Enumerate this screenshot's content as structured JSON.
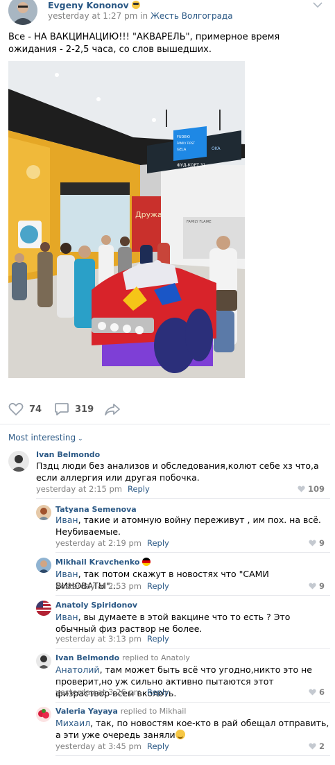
{
  "post": {
    "author": "Evgeny Kononov",
    "time": "yesterday at 1:27 pm",
    "in_word": "in",
    "group": "Жесть Волгограда",
    "text": "Все - НА ВАКЦИНАЦИЮ!!! \"АКВАРЕЛЬ\", примерное время ожидания - 2-2,5 часа, со слов вышедших.",
    "photo_signs": {
      "store_sign": "Дружать",
      "direction_board": [
        "FUDEЮ",
        "FAMILY FIRST",
        "GELA",
        "OKA",
        "ФУД-КОРТ 31"
      ],
      "shop": "FAMILY FLAIRE"
    }
  },
  "actions": {
    "likes": "74",
    "comments": "319"
  },
  "sort_label": "Most interesting",
  "colors": {
    "link": "#2a5885",
    "meta": "#828282",
    "divider": "#e7e8ec"
  },
  "comments": [
    {
      "author": "Ivan Belmondo",
      "replied": "",
      "to": "",
      "text": "Пздц люди без анализов и обследования,колют себе хз что,а если аллергия или другая побочка.",
      "time": "yesterday at 2:15 pm",
      "reply": "Reply",
      "likes": "109"
    },
    {
      "author": "Tatyana Semenova",
      "replied": "",
      "to": "Иван",
      "text": ", такие и атомную войну переживут , им пох. на всё. Неубиваемые.",
      "time": "yesterday at 2:19 pm",
      "reply": "Reply",
      "likes": "9"
    },
    {
      "author": "Mikhail Kravchenko",
      "replied": "",
      "to": "Иван",
      "text": ", так потом скажут в новостях что \"САМИ ВИНОВАТЫ\"...",
      "time": "yesterday at 2:53 pm",
      "reply": "Reply",
      "likes": "9"
    },
    {
      "author": "Anatoly Spiridonov",
      "replied": "",
      "to": "Иван",
      "text": ", вы думаете в этой вакцине что то есть ? Это обычный физ раствор не более.",
      "time": "yesterday at 3:13 pm",
      "reply": "Reply",
      "likes": ""
    },
    {
      "author": "Ivan Belmondo",
      "replied": "replied to Anatoly",
      "to": "Анатолий",
      "text": ", там может быть всё что угодно,никто это не проверит,но уж сильно активно пытаются этот физраствор всем вколоть.",
      "time": "yesterday at 3:26 pm",
      "reply": "Reply",
      "likes": "6"
    },
    {
      "author": "Valeria Yayaya",
      "replied": "replied to Mikhail",
      "to": "Михаил",
      "text": ", так, по новостям кое-кто в рай обещал отправить, а эти уже очередь заняли",
      "time": "yesterday at 3:45 pm",
      "reply": "Reply",
      "likes": "2"
    }
  ]
}
